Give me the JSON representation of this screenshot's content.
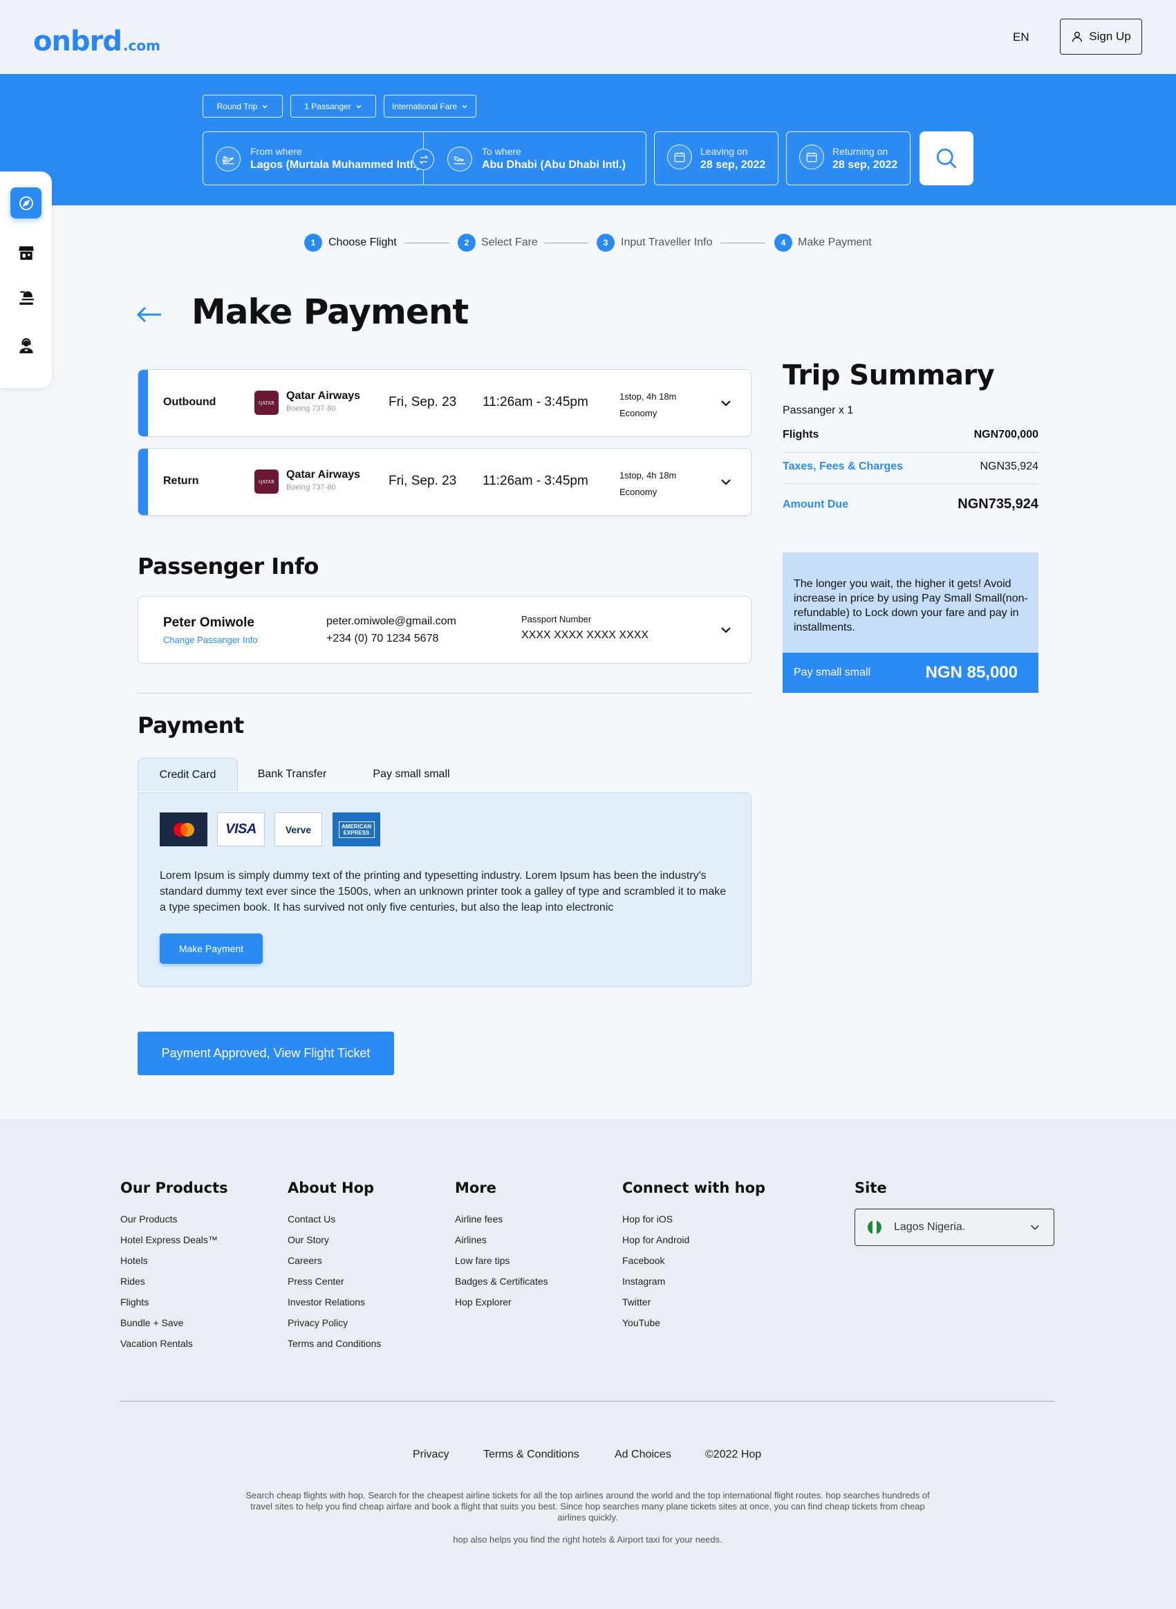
{
  "header": {
    "logo_main": "onbrd",
    "logo_tld": ".com",
    "language": "EN",
    "signup_label": "Sign Up"
  },
  "search": {
    "trip_type": "Round Trip",
    "passengers": "1 Passanger",
    "fare_type": "International Fare",
    "from_label": "From where",
    "from_value": "Lagos (Murtala Muhammed Intl.)",
    "to_label": "To where",
    "to_value": "Abu Dhabi (Abu Dhabi Intl.)",
    "leaving_label": "Leaving on",
    "leaving_value": "28 sep, 2022",
    "returning_label": "Returning on",
    "returning_value": "28 sep, 2022"
  },
  "sidenav": {
    "items": [
      "compass-icon",
      "store-icon",
      "hotel-bell-icon",
      "support-agent-icon"
    ]
  },
  "steps": [
    {
      "num": "1",
      "label": "Choose Flight"
    },
    {
      "num": "2",
      "label": "Select Fare"
    },
    {
      "num": "3",
      "label": "Input Traveller Info"
    },
    {
      "num": "4",
      "label": "Make Payment"
    }
  ],
  "page_title": "Make Payment",
  "flights": [
    {
      "direction": "Outbound",
      "airline_logo": "QATAR",
      "airline": "Qatar Airways",
      "aircraft": "Boeing 737-80",
      "date": "Fri, Sep. 23",
      "time": "11:26am - 3:45pm",
      "stops": "1stop, 4h 18m",
      "cabin": "Economy"
    },
    {
      "direction": "Return",
      "airline_logo": "QATAR",
      "airline": "Qatar Airways",
      "aircraft": "Boeing 737-80",
      "date": "Fri, Sep. 23",
      "time": "11:26am - 3:45pm",
      "stops": "1stop, 4h 18m",
      "cabin": "Economy"
    }
  ],
  "passenger": {
    "heading": "Passenger Info",
    "name": "Peter Omiwole",
    "change_link": "Change Passanger Info",
    "email": "peter.omiwole@gmail.com",
    "phone": "+234 (0) 70 1234 5678",
    "passport_label": "Passport Number",
    "passport_value": "XXXX XXXX XXXX XXXX"
  },
  "payment": {
    "heading": "Payment",
    "tabs": [
      "Credit Card",
      "Bank Transfer",
      "Pay small small"
    ],
    "cards": {
      "visa": "VISA",
      "verve": "Verve",
      "amex": "AMERICAN EXPRESS"
    },
    "description": "Lorem Ipsum is simply dummy text of the printing and typesetting industry. Lorem Ipsum has been the industry's standard dummy text ever since the 1500s, when an unknown printer took a galley of type and scrambled it to make a type specimen book. It has survived not only five centuries, but also the leap into electronic",
    "make_payment_label": "Make Payment",
    "approved_label": "Payment Approved, View Flight Ticket"
  },
  "summary": {
    "title": "Trip Summary",
    "passengers": "Passanger x 1",
    "flights_label": "Flights",
    "flights_value": "NGN700,000",
    "taxes_label": "Taxes, Fees & Charges",
    "taxes_value": "NGN35,924",
    "amount_label": "Amount Due",
    "amount_value": "NGN735,924",
    "promo_text": "The longer you wait, the higher it gets! Avoid increase in price by using Pay Small Small(non-refundable) to Lock down your fare and pay in installments.",
    "promo_label": "Pay small small",
    "promo_value": "NGN 85,000"
  },
  "footer": {
    "columns": [
      {
        "heading": "Our Products",
        "links": [
          "Our Products",
          "Hotel Express Deals™",
          "Hotels",
          "Rides",
          "Flights",
          "Bundle + Save",
          "Vacation Rentals"
        ]
      },
      {
        "heading": "About Hop",
        "links": [
          "Contact Us",
          "Our Story",
          "Careers",
          "Press Center",
          "Investor Relations",
          "Privacy Policy",
          "Terms and Conditions"
        ]
      },
      {
        "heading": "More",
        "links": [
          "Airline fees",
          "Airlines",
          "Low fare tips",
          "Badges & Certificates",
          "Hop Explorer"
        ]
      },
      {
        "heading": "Connect with hop",
        "links": [
          "Hop for iOS",
          "Hop for Android",
          "Facebook",
          "Instagram",
          "Twitter",
          "YouTube"
        ]
      }
    ],
    "site_heading": "Site",
    "site_value": "Lagos Nigeria.",
    "bottom_links": [
      "Privacy",
      "Terms & Conditions",
      "Ad Choices",
      "©2022 Hop"
    ],
    "para1": "Search cheap flights with hop. Search for the cheapest airline tickets for all the top airlines around the world and the top international flight routes. hop searches hundreds of travel sites to help you find cheap airfare and book a flight that suits you best. Since hop searches many plane tickets sites at once, you can find cheap tickets from cheap airlines quickly.",
    "para2": "hop also helps you find the right hotels & Airport taxi for your needs."
  },
  "colors": {
    "brand": "#2c8bf2",
    "promo_bg": "#c6ddf8",
    "card_bg": "#e3eefb",
    "airline": "#6b1836",
    "footer_bg": "#e8eef4"
  }
}
